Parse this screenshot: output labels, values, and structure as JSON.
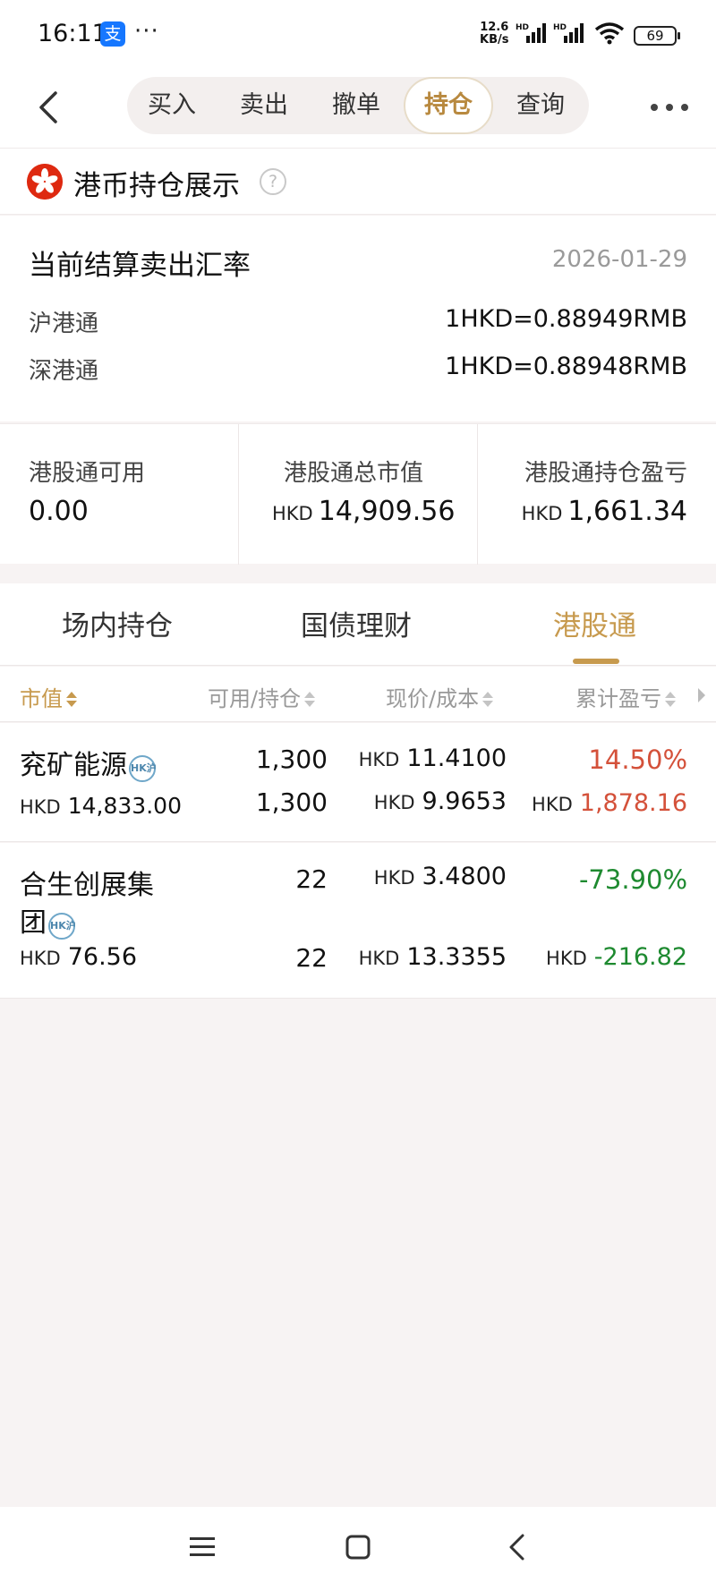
{
  "status_bar": {
    "time": "16:11",
    "app_badge": "支",
    "more_dots": "···",
    "net_speed_value": "12.6",
    "net_speed_unit": "KB/s",
    "signal_label": "HD",
    "battery": "69"
  },
  "nav": {
    "tabs": [
      {
        "label": "买入"
      },
      {
        "label": "卖出"
      },
      {
        "label": "撤单"
      },
      {
        "label": "持仓"
      },
      {
        "label": "查询"
      }
    ],
    "active_tab": "持仓"
  },
  "header": {
    "title": "港币持仓展示",
    "help": "?"
  },
  "rate": {
    "title": "当前结算卖出汇率",
    "date": "2026-01-29",
    "rows": [
      {
        "label": "沪港通",
        "value": "1HKD=0.88949RMB"
      },
      {
        "label": "深港通",
        "value": "1HKD=0.88948RMB"
      }
    ]
  },
  "summary": {
    "available_label": "港股通可用",
    "available_value": "0.00",
    "market_value_label": "港股通总市值",
    "market_value_currency": "HKD",
    "market_value": "14,909.56",
    "pnl_label": "港股通持仓盈亏",
    "pnl_currency": "HKD",
    "pnl_value": "1,661.34"
  },
  "subtabs": {
    "items": [
      {
        "label": "场内持仓"
      },
      {
        "label": "国债理财"
      },
      {
        "label": "港股通"
      }
    ],
    "active": "港股通"
  },
  "table": {
    "headers": [
      "市值",
      "可用/持仓",
      "现价/成本",
      "累计盈亏"
    ],
    "rows": [
      {
        "name": "兖矿能源",
        "badge": "HK沪",
        "mv_currency": "HKD",
        "market_value": "14,833.00",
        "available": "1,300",
        "holding": "1,300",
        "price_currency": "HKD",
        "price": "11.4100",
        "cost_currency": "HKD",
        "cost": "9.9653",
        "pnl_pct": "14.50%",
        "pnl_currency": "HKD",
        "pnl": "1,878.16"
      },
      {
        "name_line1": "合生创展集",
        "name_line2": "团",
        "badge": "HK沪",
        "mv_currency": "HKD",
        "market_value": "76.56",
        "available": "22",
        "holding": "22",
        "price_currency": "HKD",
        "price": "3.4800",
        "cost_currency": "HKD",
        "cost": "13.3355",
        "pnl_pct": "-73.90%",
        "pnl_currency": "HKD",
        "pnl": "-216.82"
      }
    ]
  },
  "colors": {
    "accent_gold": "#c79a4e",
    "profit_red": "#d4513a",
    "loss_green": "#1e8a30"
  }
}
